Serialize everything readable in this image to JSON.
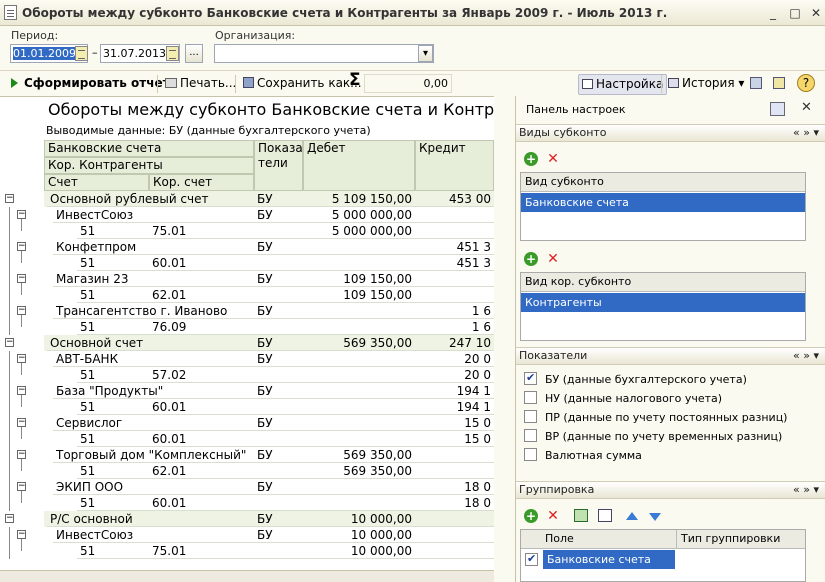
{
  "window": {
    "title": "Обороты между субконто Банковские счета и Контрагенты за Январь 2009 г. - Июль 2013 г.",
    "min": "_",
    "max": "□",
    "close": "✕"
  },
  "filters": {
    "period_label": "Период:",
    "date_from": "01.01.2009",
    "date_to": "31.07.2013",
    "ellipsis": "...",
    "org_label": "Организация:",
    "org_value": ""
  },
  "toolbar": {
    "generate": "Сформировать отчет",
    "print": "Печать...",
    "save": "Сохранить как...",
    "sum_symbol": "Σ",
    "sum_value": "0,00",
    "settings": "Настройка",
    "history": "История",
    "help": "?"
  },
  "report": {
    "title": "Обороты между субконто Банковские счета и Контрагенты",
    "subtitle": "Выводимые данные:  БУ (данные бухгалтерского учета)",
    "headers": {
      "bank": "Банковские счета",
      "contr": "Кор. Контрагенты",
      "account": "Счет",
      "cor_account": "Кор. счет",
      "indicators": "Показа\nтели",
      "debit": "Дебет",
      "credit": "Кредит"
    },
    "rows": [
      {
        "level": 0,
        "name": "Основной рублевый счет",
        "cor": "",
        "ind": "БУ",
        "debit": "5 109 150,00",
        "credit": "453 00"
      },
      {
        "level": 1,
        "name": "ИнвестСоюз",
        "cor": "",
        "ind": "БУ",
        "debit": "5 000 000,00",
        "credit": ""
      },
      {
        "level": 2,
        "name": "51",
        "cor": "75.01",
        "ind": "",
        "debit": "5 000 000,00",
        "credit": ""
      },
      {
        "level": 1,
        "name": "Конфетпром",
        "cor": "",
        "ind": "БУ",
        "debit": "",
        "credit": "451 3"
      },
      {
        "level": 2,
        "name": "51",
        "cor": "60.01",
        "ind": "",
        "debit": "",
        "credit": "451 3"
      },
      {
        "level": 1,
        "name": "Магазин 23",
        "cor": "",
        "ind": "БУ",
        "debit": "109 150,00",
        "credit": ""
      },
      {
        "level": 2,
        "name": "51",
        "cor": "62.01",
        "ind": "",
        "debit": "109 150,00",
        "credit": ""
      },
      {
        "level": 1,
        "name": "Трансагентство г. Иваново",
        "cor": "",
        "ind": "БУ",
        "debit": "",
        "credit": "1 6"
      },
      {
        "level": 2,
        "name": "51",
        "cor": "76.09",
        "ind": "",
        "debit": "",
        "credit": "1 6"
      },
      {
        "level": 0,
        "name": "Основной счет",
        "cor": "",
        "ind": "БУ",
        "debit": "569 350,00",
        "credit": "247 10"
      },
      {
        "level": 1,
        "name": "АВТ-БАНК",
        "cor": "",
        "ind": "БУ",
        "debit": "",
        "credit": "20 0"
      },
      {
        "level": 2,
        "name": "51",
        "cor": "57.02",
        "ind": "",
        "debit": "",
        "credit": "20 0"
      },
      {
        "level": 1,
        "name": "База \"Продукты\"",
        "cor": "",
        "ind": "БУ",
        "debit": "",
        "credit": "194 1"
      },
      {
        "level": 2,
        "name": "51",
        "cor": "60.01",
        "ind": "",
        "debit": "",
        "credit": "194 1"
      },
      {
        "level": 1,
        "name": "Сервислог",
        "cor": "",
        "ind": "БУ",
        "debit": "",
        "credit": "15 0"
      },
      {
        "level": 2,
        "name": "51",
        "cor": "60.01",
        "ind": "",
        "debit": "",
        "credit": "15 0"
      },
      {
        "level": 1,
        "name": "Торговый дом \"Комплексный\"",
        "cor": "",
        "ind": "БУ",
        "debit": "569 350,00",
        "credit": ""
      },
      {
        "level": 2,
        "name": "51",
        "cor": "62.01",
        "ind": "",
        "debit": "569 350,00",
        "credit": ""
      },
      {
        "level": 1,
        "name": "ЭКИП ООО",
        "cor": "",
        "ind": "БУ",
        "debit": "",
        "credit": "18 0"
      },
      {
        "level": 2,
        "name": "51",
        "cor": "60.01",
        "ind": "",
        "debit": "",
        "credit": "18 0"
      },
      {
        "level": 0,
        "name": "Р/С основной",
        "cor": "",
        "ind": "БУ",
        "debit": "10 000,00",
        "credit": ""
      },
      {
        "level": 1,
        "name": "ИнвестСоюз",
        "cor": "",
        "ind": "БУ",
        "debit": "10 000,00",
        "credit": ""
      },
      {
        "level": 2,
        "name": "51",
        "cor": "75.01",
        "ind": "",
        "debit": "10 000,00",
        "credit": ""
      }
    ]
  },
  "panel": {
    "title": "Панель настроек",
    "close": "✕",
    "sub_section": "Виды субконто",
    "sub_header": "Вид субконто",
    "sub_value": "Банковские счета",
    "cor_header": "Вид кор. субконто",
    "cor_value": "Контрагенты",
    "ind_section": "Показатели",
    "indicators": [
      {
        "label": "БУ (данные бухгалтерского учета)",
        "checked": true
      },
      {
        "label": "НУ (данные налогового учета)",
        "checked": false
      },
      {
        "label": "ПР (данные по учету постоянных разниц)",
        "checked": false
      },
      {
        "label": "ВР (данные по учету временных разниц)",
        "checked": false
      },
      {
        "label": "Валютная сумма",
        "checked": false
      }
    ],
    "grp_section": "Группировка",
    "grp_field": "Поле",
    "grp_type": "Тип группировки",
    "grp_value": "Банковские счета",
    "sec_ctrl": "« » ▾"
  }
}
